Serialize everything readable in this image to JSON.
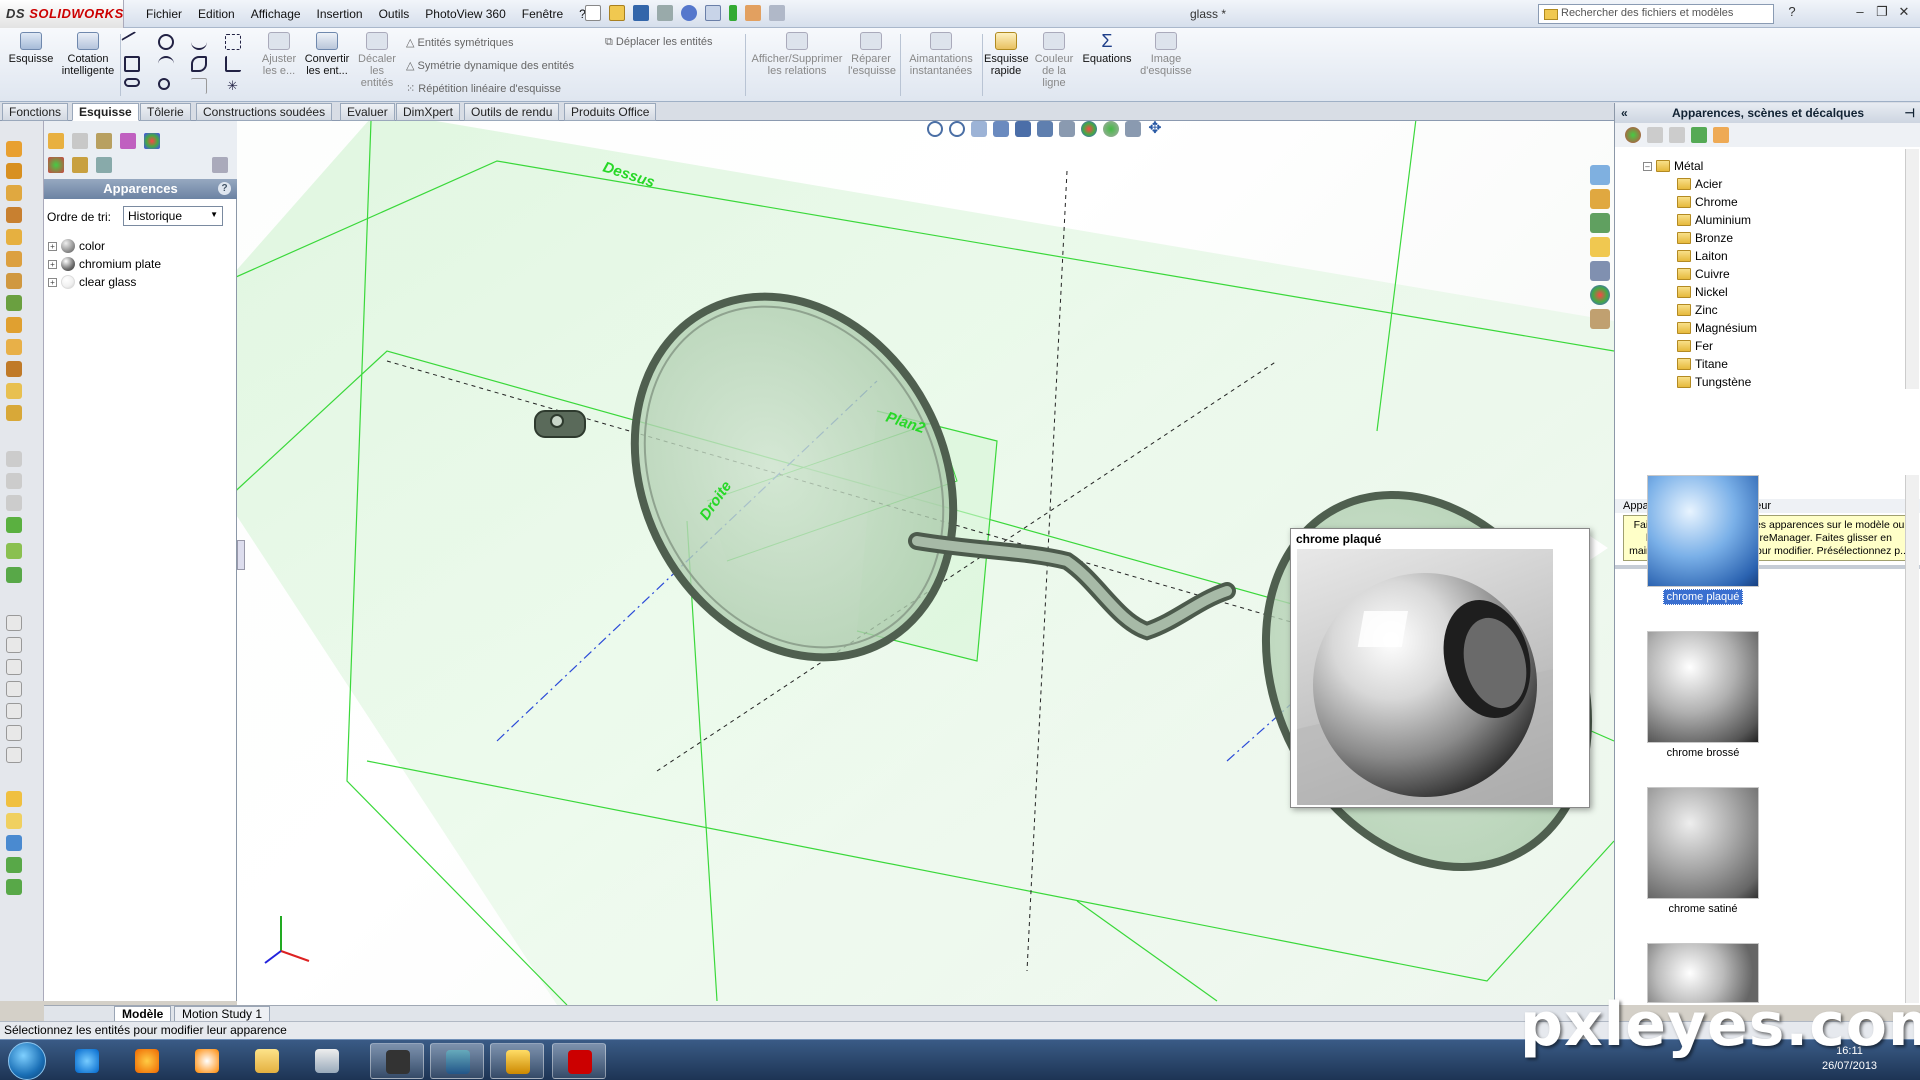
{
  "app": {
    "brand_prefix": "DS",
    "brand": "SOLIDWORKS",
    "document_title": "glass *"
  },
  "menu": [
    "Fichier",
    "Edition",
    "Affichage",
    "Insertion",
    "Outils",
    "PhotoView 360",
    "Fenêtre",
    "?"
  ],
  "search": {
    "placeholder": "Rechercher des fichiers et modèles"
  },
  "ribbon": {
    "esquisse": "Esquisse",
    "cotation": "Cotation intelligente",
    "ajuster": "Ajuster les e...",
    "convertir": "Convertir les ent...",
    "decaler": "Décaler les entités",
    "symetriques": "Entités symétriques",
    "symetrie_dyn": "Symétrie dynamique des entités",
    "repetition": "Répétition linéaire d'esquisse",
    "deplacer": "Déplacer les entités",
    "relations": "Afficher/Supprimer les relations",
    "reparer": "Réparer l'esquisse",
    "aimantations": "Aimantations instantanées",
    "esq_rapide": "Esquisse rapide",
    "couleur_ligne": "Couleur de la ligne",
    "equations": "Equations",
    "image_esq": "Image d'esquisse"
  },
  "tabs": [
    "Fonctions",
    "Esquisse",
    "Tôlerie",
    "Constructions soudées",
    "Evaluer",
    "DimXpert",
    "Outils de rendu",
    "Produits Office"
  ],
  "active_tab": "Esquisse",
  "feature_manager": {
    "title": "Apparences",
    "help": "?",
    "sort_label": "Ordre de tri:",
    "sort_value": "Historique",
    "items": [
      {
        "label": "color",
        "color": "#8a8a8a"
      },
      {
        "label": "chromium plate",
        "color": "#6d6d6d"
      },
      {
        "label": "clear glass",
        "color": "#f0f0f0"
      }
    ]
  },
  "viewport": {
    "plane_top": "Dessus",
    "plane_right": "Droite",
    "plane_2": "Plan2"
  },
  "preview": {
    "title": "chrome plaqué"
  },
  "task_pane": {
    "title": "Apparences, scènes et décalques",
    "root": "Métal",
    "materials": [
      "Acier",
      "Chrome",
      "Aluminium",
      "Bronze",
      "Laiton",
      "Cuivre",
      "Nickel",
      "Zinc",
      "Magnésium",
      "Fer",
      "Titane",
      "Tungstène"
    ],
    "default_label": "Apparence par défaut: couleur",
    "hint": "Faites glisser et déposez les apparences sur le modèle ou l'arbre de création FeatureManager. Faites glisser en maintenant la touche ALT pour modifier. Présélectionnez p...",
    "swatches": [
      {
        "label": "chrome plaqué",
        "selected": true
      },
      {
        "label": "chrome brossé",
        "selected": false
      },
      {
        "label": "chrome satiné",
        "selected": false
      }
    ]
  },
  "bottom_tabs": [
    "Modèle",
    "Motion Study 1"
  ],
  "status": "Sélectionnez les entités pour modifier leur apparence",
  "clock": {
    "time": "16:11",
    "date": "26/07/2013"
  },
  "watermark": "pxleyes.com",
  "colors": {
    "accent": "#3a6fd0",
    "plane": "#27d827",
    "brand": "#cc0000"
  }
}
